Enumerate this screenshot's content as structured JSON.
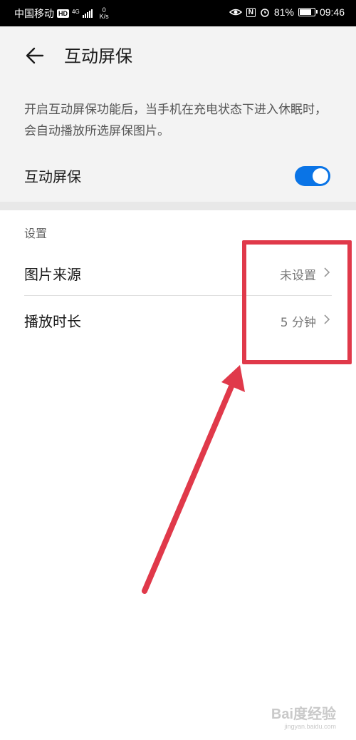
{
  "status_bar": {
    "carrier": "中国移动",
    "hd_badge": "HD",
    "network": "4G",
    "speed_value": "0",
    "speed_unit": "K/s",
    "nfc": "N",
    "battery": "81%",
    "battery_level": 0.81,
    "time": "09:46"
  },
  "header": {
    "title": "互动屏保"
  },
  "main": {
    "description": "开启互动屏保功能后，当手机在充电状态下进入休眠时，会自动播放所选屏保图片。",
    "toggle_label": "互动屏保",
    "toggle_on": true
  },
  "settings": {
    "section_title": "设置",
    "rows": [
      {
        "label": "图片来源",
        "value": "未设置"
      },
      {
        "label": "播放时长",
        "value": "5 分钟"
      }
    ]
  },
  "annotation": {
    "color": "#e0394a"
  },
  "colors": {
    "accent": "#0a74e6"
  },
  "watermark": {
    "main": "Bai度经验",
    "sub": "jingyan.baidu.com"
  }
}
